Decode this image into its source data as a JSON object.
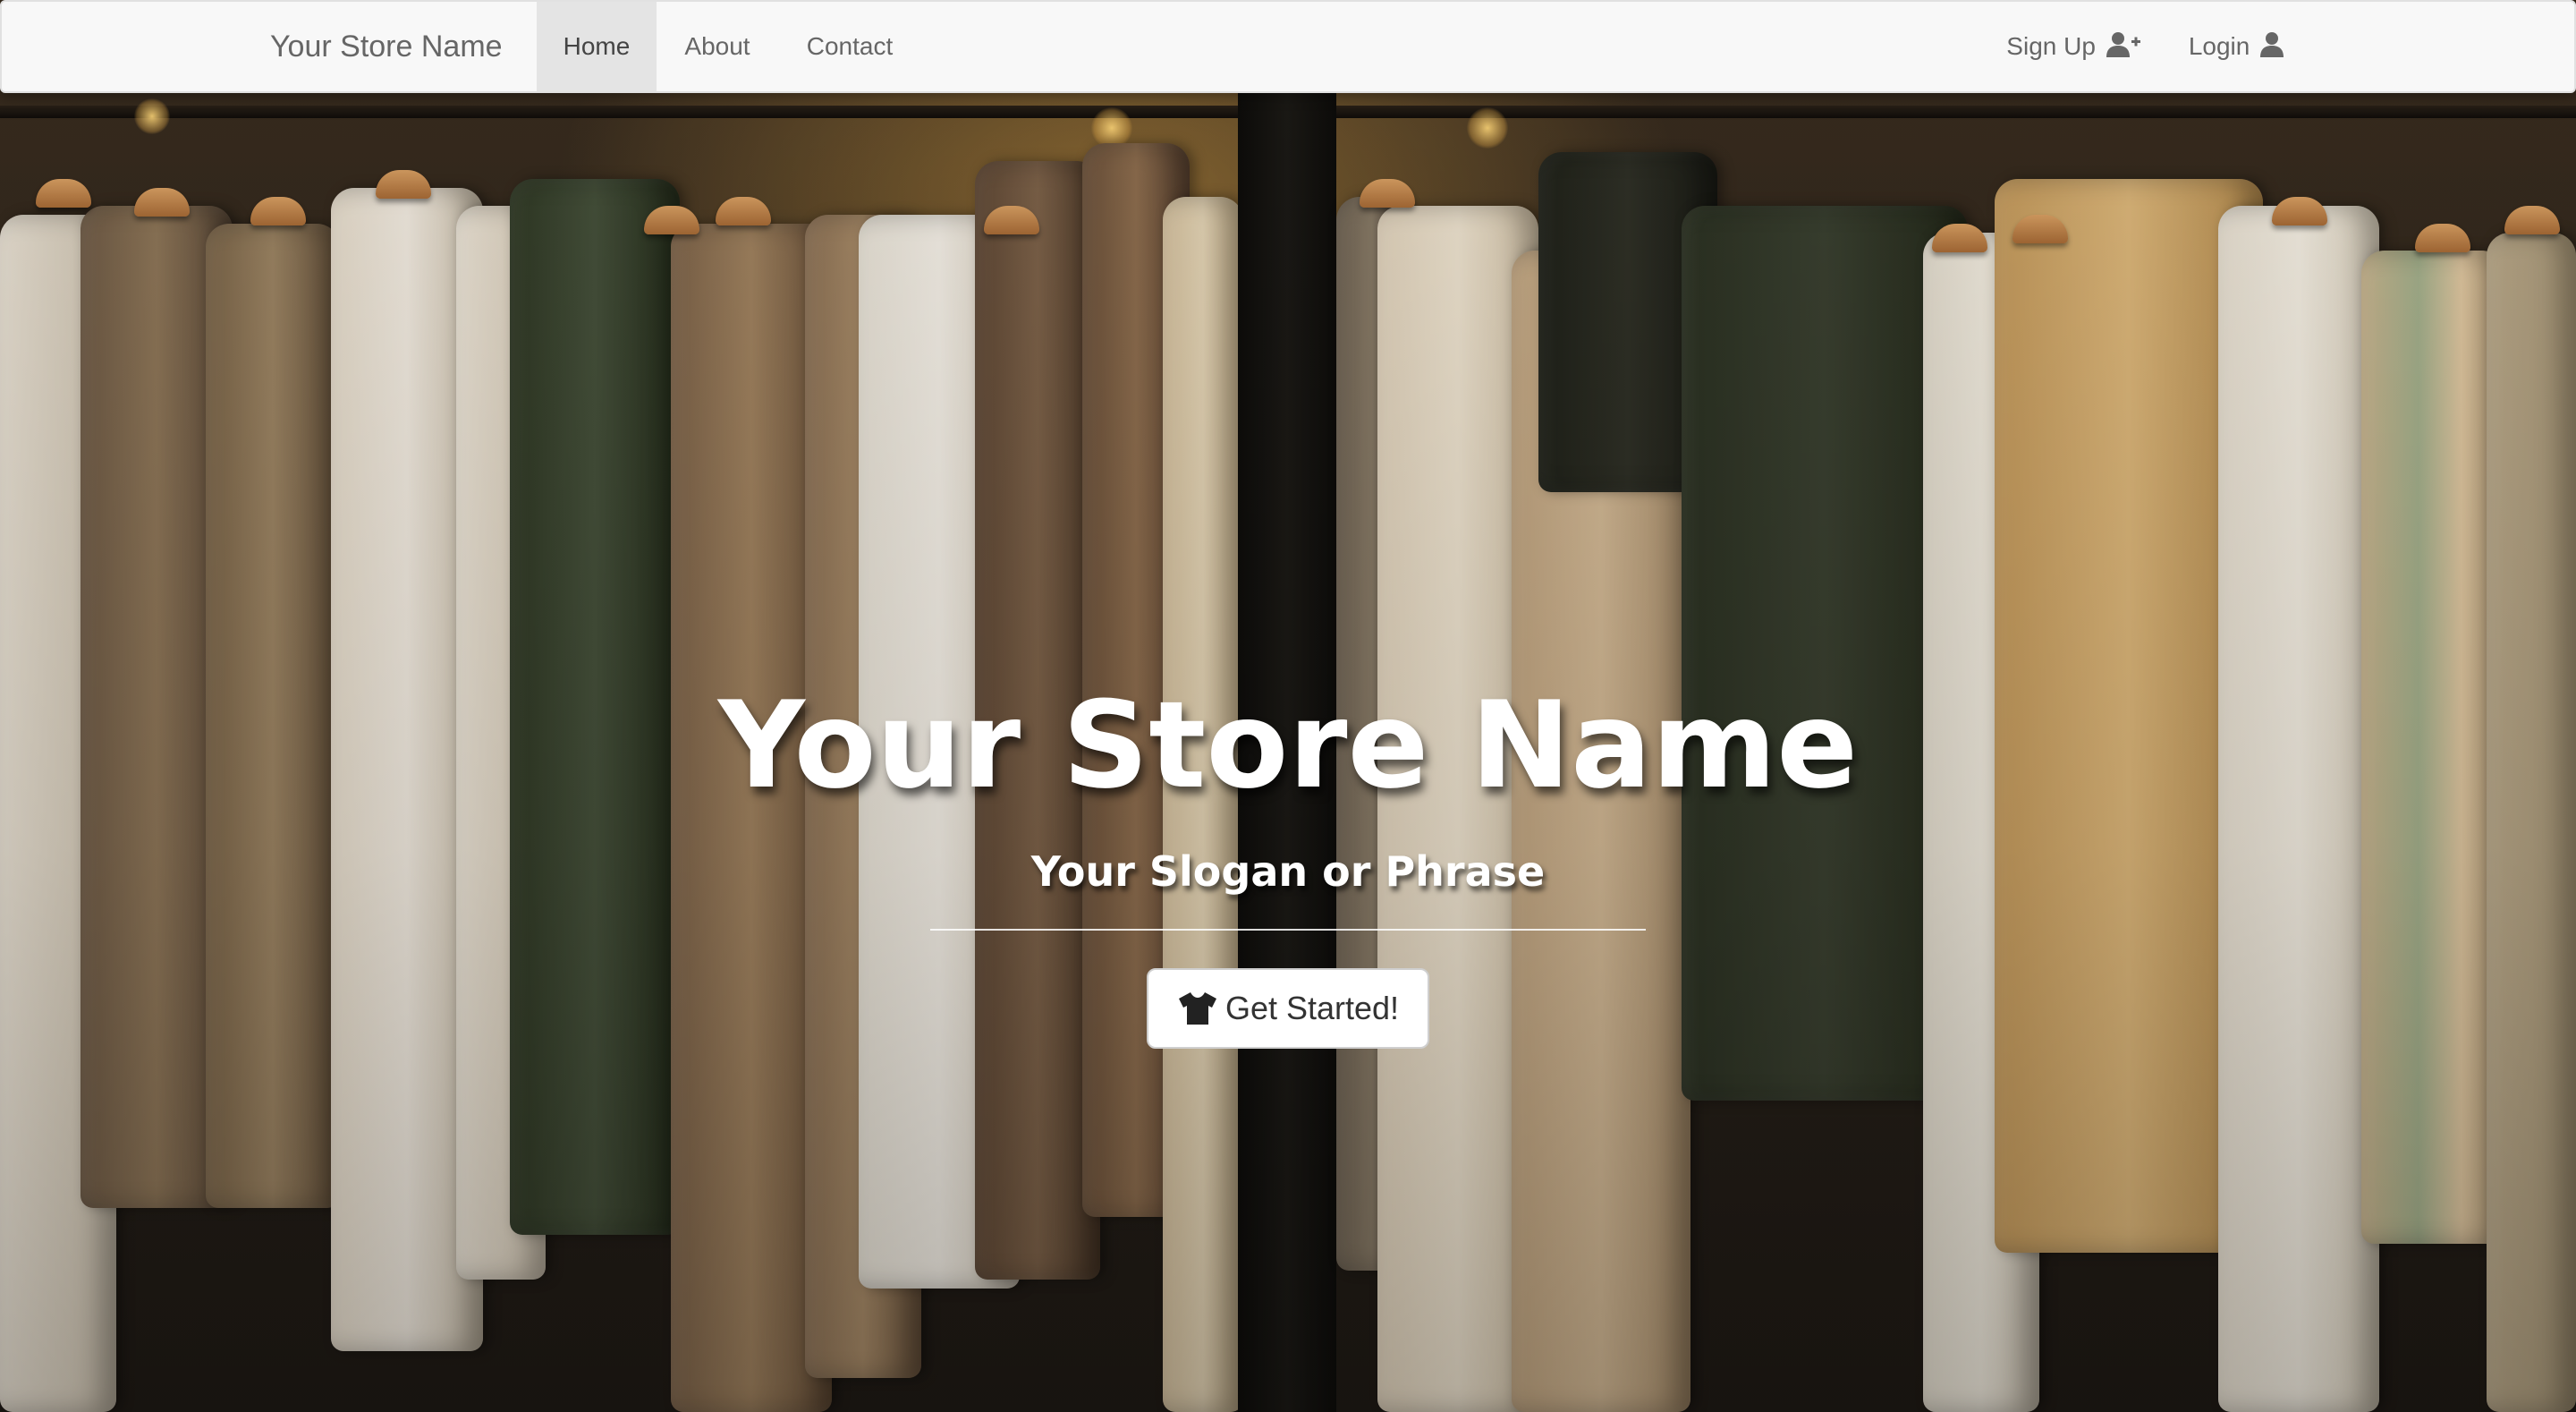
{
  "navbar": {
    "brand": "Your Store Name",
    "links": [
      {
        "label": "Home",
        "active": true
      },
      {
        "label": "About",
        "active": false
      },
      {
        "label": "Contact",
        "active": false
      }
    ],
    "right_links": [
      {
        "label": "Sign Up",
        "icon": "user-plus-icon"
      },
      {
        "label": "Login",
        "icon": "user-icon"
      }
    ]
  },
  "hero": {
    "title": "Your Store Name",
    "slogan": "Your Slogan or Phrase",
    "cta_label": "Get Started!",
    "cta_icon": "tshirt-icon",
    "background": "clothing-rack-photo"
  },
  "colors": {
    "navbar_bg": "#f8f8f8",
    "active_link_bg": "#e4e4e4",
    "hero_text": "#ffffff",
    "button_bg": "#ffffff"
  }
}
